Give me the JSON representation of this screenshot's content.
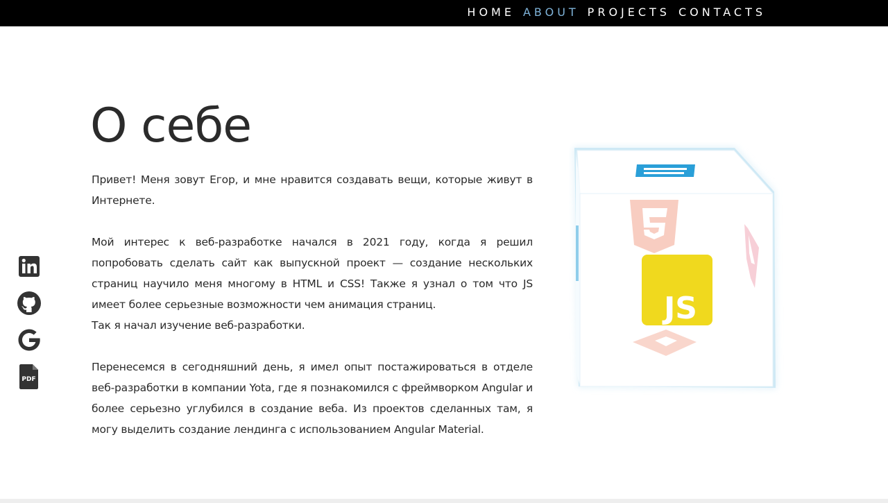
{
  "nav": {
    "items": [
      "HOME",
      "ABOUT",
      "PROJECTS",
      "CONTACTS"
    ],
    "active_index": 1,
    "active_color": "#7fb3d9"
  },
  "about": {
    "title": "О себе",
    "paragraphs": [
      [
        "Привет! Меня зовут Егор, и мне нравится создавать вещи, которые живут в Интернете."
      ],
      [
        "Мой интерес к веб-разработке начался в 2021 году, когда я решил попробовать сделать сайт как выпускной проект — создание нескольких страниц научило меня многому в HTML и CSS! Также я узнал о том что JS имеет более серьезные возможности чем анимация страниц.",
        "Так я начал изучение веб-разработки."
      ],
      [
        "Перенесемся в сегодняшний день, я имел опыт постажироваться в отделе веб-разработки в компании Yota, где я познакомился с фреймворком Angular и более серьезно углубился в создание веба. Из проектов сделанных там, я могу выделить создание лендинга с использованием Angular Material."
      ]
    ]
  },
  "social": [
    {
      "icon": "linkedin-icon"
    },
    {
      "icon": "github-icon"
    },
    {
      "icon": "google-icon"
    },
    {
      "icon": "pdf-icon",
      "label": "PDF"
    }
  ],
  "cube": {
    "front_logo": "JS",
    "faces": [
      "html5-icon",
      "css3-icon",
      "js-icon",
      "angular-icon",
      "sass-icon"
    ],
    "colors": {
      "js_bg": "#f0d91e",
      "js_text": "#ffffff",
      "css": "#f5b7a8",
      "angular": "#f2a7b4",
      "html_top": "#2a9fd8"
    }
  }
}
